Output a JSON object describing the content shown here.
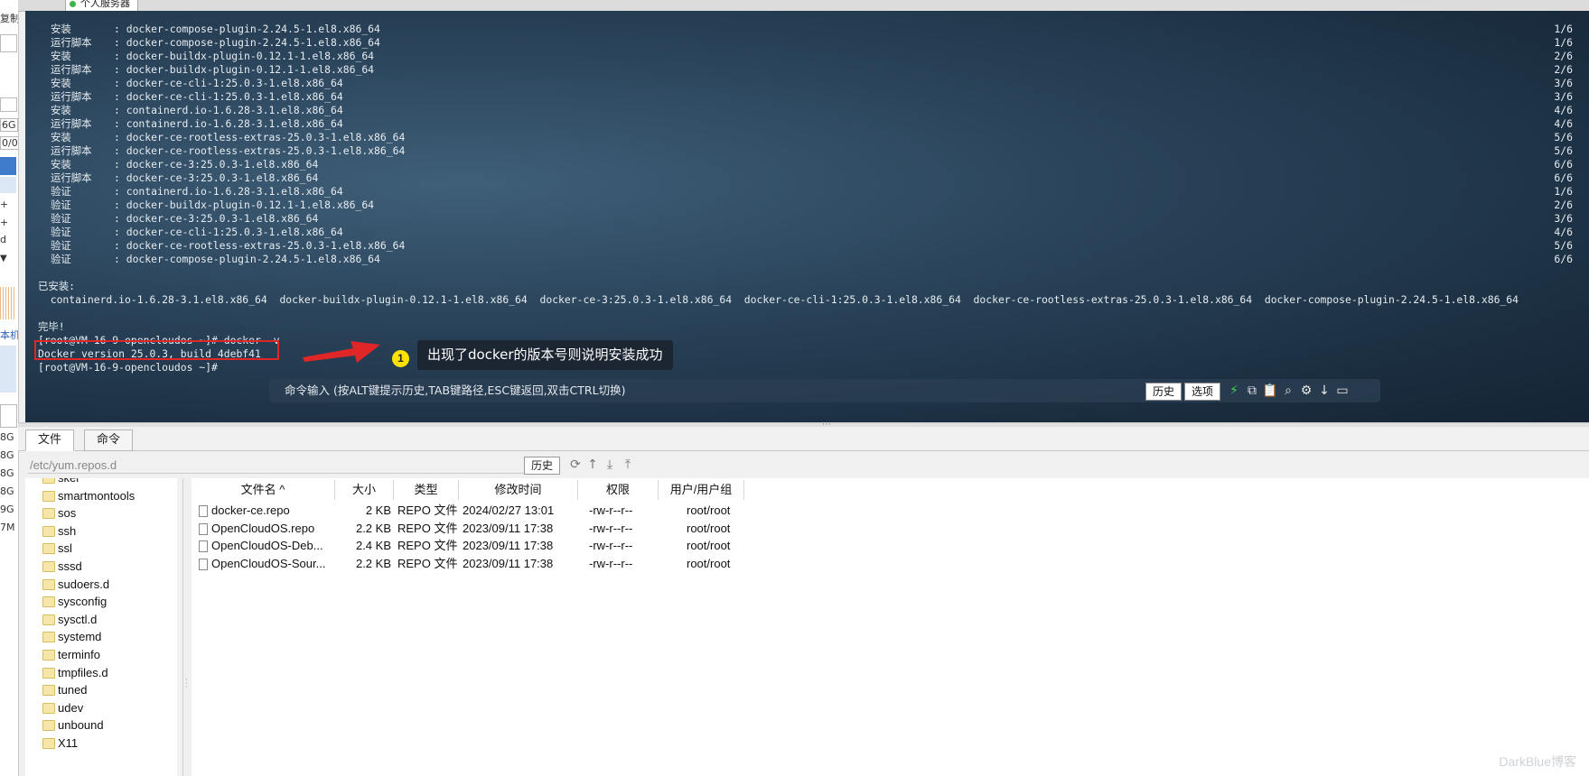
{
  "left_strip": {
    "items": [
      "复制",
      "6G",
      "0/0",
      "+",
      "+",
      "d",
      "本机",
      "8G",
      "8G",
      "8G",
      "8G",
      "9G",
      "7M"
    ]
  },
  "session_tab": {
    "title": "个人服务器"
  },
  "terminal": {
    "transactions": [
      {
        "action": "安装",
        "pkg": "docker-compose-plugin-2.24.5-1.el8.x86_64",
        "count": "1/6"
      },
      {
        "action": "运行脚本",
        "pkg": "docker-compose-plugin-2.24.5-1.el8.x86_64",
        "count": "1/6"
      },
      {
        "action": "安装",
        "pkg": "docker-buildx-plugin-0.12.1-1.el8.x86_64",
        "count": "2/6"
      },
      {
        "action": "运行脚本",
        "pkg": "docker-buildx-plugin-0.12.1-1.el8.x86_64",
        "count": "2/6"
      },
      {
        "action": "安装",
        "pkg": "docker-ce-cli-1:25.0.3-1.el8.x86_64",
        "count": "3/6"
      },
      {
        "action": "运行脚本",
        "pkg": "docker-ce-cli-1:25.0.3-1.el8.x86_64",
        "count": "3/6"
      },
      {
        "action": "安装",
        "pkg": "containerd.io-1.6.28-3.1.el8.x86_64",
        "count": "4/6"
      },
      {
        "action": "运行脚本",
        "pkg": "containerd.io-1.6.28-3.1.el8.x86_64",
        "count": "4/6"
      },
      {
        "action": "安装",
        "pkg": "docker-ce-rootless-extras-25.0.3-1.el8.x86_64",
        "count": "5/6"
      },
      {
        "action": "运行脚本",
        "pkg": "docker-ce-rootless-extras-25.0.3-1.el8.x86_64",
        "count": "5/6"
      },
      {
        "action": "安装",
        "pkg": "docker-ce-3:25.0.3-1.el8.x86_64",
        "count": "6/6"
      },
      {
        "action": "运行脚本",
        "pkg": "docker-ce-3:25.0.3-1.el8.x86_64",
        "count": "6/6"
      },
      {
        "action": "验证",
        "pkg": "containerd.io-1.6.28-3.1.el8.x86_64",
        "count": "1/6"
      },
      {
        "action": "验证",
        "pkg": "docker-buildx-plugin-0.12.1-1.el8.x86_64",
        "count": "2/6"
      },
      {
        "action": "验证",
        "pkg": "docker-ce-3:25.0.3-1.el8.x86_64",
        "count": "3/6"
      },
      {
        "action": "验证",
        "pkg": "docker-ce-cli-1:25.0.3-1.el8.x86_64",
        "count": "4/6"
      },
      {
        "action": "验证",
        "pkg": "docker-ce-rootless-extras-25.0.3-1.el8.x86_64",
        "count": "5/6"
      },
      {
        "action": "验证",
        "pkg": "docker-compose-plugin-2.24.5-1.el8.x86_64",
        "count": "6/6"
      }
    ],
    "installed_header": "已安装:",
    "installed_list": "  containerd.io-1.6.28-3.1.el8.x86_64  docker-buildx-plugin-0.12.1-1.el8.x86_64  docker-ce-3:25.0.3-1.el8.x86_64  docker-ce-cli-1:25.0.3-1.el8.x86_64  docker-ce-rootless-extras-25.0.3-1.el8.x86_64  docker-compose-plugin-2.24.5-1.el8.x86_64",
    "done": "完毕!",
    "prompt_cmd": "[root@VM-16-9-opencloudos ~]# docker -v",
    "version_output": "Docker version 25.0.3, build 4debf41",
    "prompt_end": "[root@VM-16-9-opencloudos ~]#",
    "annotation_number": "1",
    "annotation_text": "出现了docker的版本号则说明安装成功",
    "cmd_placeholder": "命令输入 (按ALT键提示历史,TAB键路径,ESC键返回,双击CTRL切换)",
    "history_label": "历史",
    "options_label": "选项"
  },
  "bottom_tabs": {
    "files": "文件",
    "commands": "命令"
  },
  "path_bar": {
    "path": "/etc/yum.repos.d",
    "history_label": "历史"
  },
  "tree": {
    "folders": [
      "skel",
      "smartmontools",
      "sos",
      "ssh",
      "ssl",
      "sssd",
      "sudoers.d",
      "sysconfig",
      "sysctl.d",
      "systemd",
      "terminfo",
      "tmpfiles.d",
      "tuned",
      "udev",
      "unbound",
      "X11"
    ]
  },
  "file_table": {
    "columns": [
      "文件名 ^",
      "大小",
      "类型",
      "修改时间",
      "权限",
      "用户/用户组"
    ],
    "rows": [
      {
        "name": "docker-ce.repo",
        "size": "2 KB",
        "type": "REPO 文件",
        "mtime": "2024/02/27 13:01",
        "perm": "-rw-r--r--",
        "owner": "root/root"
      },
      {
        "name": "OpenCloudOS.repo",
        "size": "2.2 KB",
        "type": "REPO 文件",
        "mtime": "2023/09/11 17:38",
        "perm": "-rw-r--r--",
        "owner": "root/root"
      },
      {
        "name": "OpenCloudOS-Deb...",
        "size": "2.4 KB",
        "type": "REPO 文件",
        "mtime": "2023/09/11 17:38",
        "perm": "-rw-r--r--",
        "owner": "root/root"
      },
      {
        "name": "OpenCloudOS-Sour...",
        "size": "2.2 KB",
        "type": "REPO 文件",
        "mtime": "2023/09/11 17:38",
        "perm": "-rw-r--r--",
        "owner": "root/root"
      }
    ]
  },
  "watermark": "DarkBlue博客",
  "colors": {
    "terminal_bg": "#2b455c",
    "highlight_box": "#e02626",
    "annotation_badge": "#ffe100",
    "folder": "#f7e6a9"
  }
}
